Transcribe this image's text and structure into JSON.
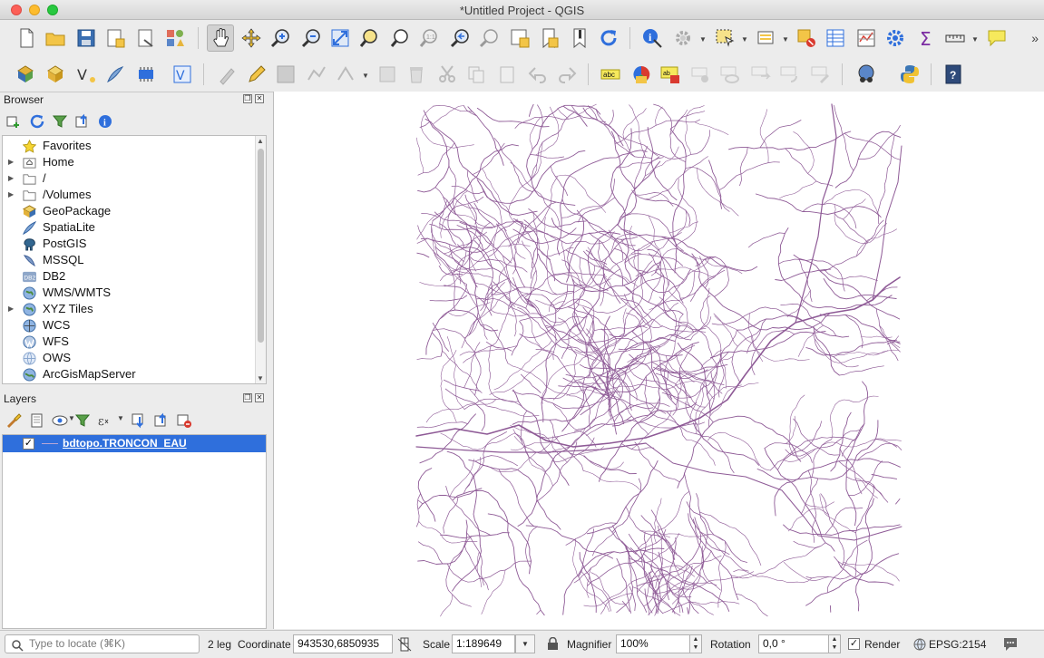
{
  "window": {
    "title": "*Untitled Project - QGIS"
  },
  "toolbar_overflow": "»",
  "browser": {
    "title": "Browser",
    "items": [
      {
        "label": "Favorites",
        "icon": "star-icon",
        "expandable": false
      },
      {
        "label": "Home",
        "icon": "home-folder-icon",
        "expandable": true
      },
      {
        "label": "/",
        "icon": "folder-icon",
        "expandable": true
      },
      {
        "label": "/Volumes",
        "icon": "folder-icon",
        "expandable": true
      },
      {
        "label": "GeoPackage",
        "icon": "geopackage-icon",
        "expandable": false
      },
      {
        "label": "SpatiaLite",
        "icon": "spatialite-icon",
        "expandable": false
      },
      {
        "label": "PostGIS",
        "icon": "postgis-elephant-icon",
        "expandable": false
      },
      {
        "label": "MSSQL",
        "icon": "mssql-icon",
        "expandable": false
      },
      {
        "label": "DB2",
        "icon": "db2-icon",
        "expandable": false
      },
      {
        "label": "WMS/WMTS",
        "icon": "globe-icon",
        "expandable": false
      },
      {
        "label": "XYZ Tiles",
        "icon": "globe-icon",
        "expandable": true
      },
      {
        "label": "WCS",
        "icon": "globe-icon",
        "expandable": false
      },
      {
        "label": "WFS",
        "icon": "wfs-globe-icon",
        "expandable": false
      },
      {
        "label": "OWS",
        "icon": "ows-globe-icon",
        "expandable": false
      },
      {
        "label": "ArcGisMapServer",
        "icon": "arcgis-globe-icon",
        "expandable": false
      }
    ],
    "db2_icon_text": "DB2"
  },
  "layers": {
    "title": "Layers",
    "items": [
      {
        "label": "bdtopo.TRONCON_EAU",
        "checked": true,
        "selected": true,
        "stroke_color": "#b9a7d6"
      }
    ]
  },
  "map": {
    "line_color": "#8e5a96",
    "background": "#ffffff"
  },
  "statusbar": {
    "locate_placeholder": "Type to locate (⌘K)",
    "legend_text": "2 leg",
    "coordinate_label": "Coordinate",
    "coordinate_value": "943530,6850935",
    "scale_label": "Scale",
    "scale_value": "1:189649",
    "magnifier_label": "Magnifier",
    "magnifier_value": "100%",
    "rotation_label": "Rotation",
    "rotation_value": "0,0 °",
    "render_label": "Render",
    "render_checked": true,
    "crs_value": "EPSG:2154"
  },
  "colors": {
    "selection": "#2f6fdc",
    "river": "#8e5a96"
  }
}
